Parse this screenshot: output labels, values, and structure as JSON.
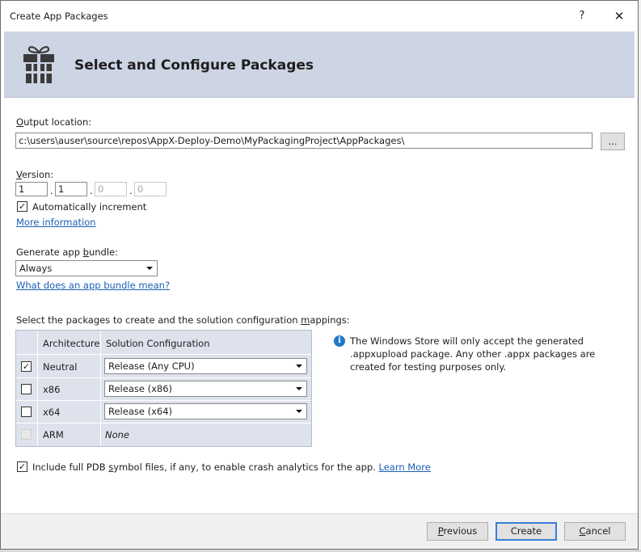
{
  "window": {
    "title": "Create App Packages",
    "help_label": "?",
    "close_label": "✕"
  },
  "header": {
    "title": "Select and Configure Packages",
    "icon": "package-gift-icon"
  },
  "output": {
    "label_prefix": "",
    "label_accel": "O",
    "label_rest": "utput location:",
    "value": "c:\\users\\auser\\source\\repos\\AppX-Deploy-Demo\\MyPackagingProject\\AppPackages\\",
    "browse_label": "..."
  },
  "version": {
    "label_accel": "V",
    "label_rest": "ersion:",
    "parts": [
      "1",
      "1",
      "0",
      "0"
    ],
    "separator": ".",
    "auto_increment_label": "Automatically increment",
    "auto_increment_checked": true,
    "more_info_link": "More information"
  },
  "bundle": {
    "label_prefix": "Generate app ",
    "label_accel": "b",
    "label_rest": "undle:",
    "selected": "Always",
    "help_link": "What does an app bundle mean?"
  },
  "packages": {
    "label_prefix": "Select the packages to create and the solution configuration ",
    "label_accel": "m",
    "label_rest": "appings:",
    "columns": [
      "Architecture",
      "Solution Configuration"
    ],
    "rows": [
      {
        "checked": true,
        "enabled": true,
        "arch": "Neutral",
        "config": "Release (Any CPU)",
        "has_combo": true
      },
      {
        "checked": false,
        "enabled": true,
        "arch": "x86",
        "config": "Release (x86)",
        "has_combo": true
      },
      {
        "checked": false,
        "enabled": true,
        "arch": "x64",
        "config": "Release (x64)",
        "has_combo": true
      },
      {
        "checked": false,
        "enabled": false,
        "arch": "ARM",
        "config": "None",
        "has_combo": false
      }
    ],
    "info_text": "The Windows Store will only accept the generated .appxupload package. Any other .appx packages are created for testing purposes only."
  },
  "pdb": {
    "checked": true,
    "label_prefix": "Include full PDB ",
    "label_accel": "s",
    "label_rest": "ymbol files, if any, to enable crash analytics for the app.",
    "learn_more_link": "Learn More"
  },
  "footer": {
    "previous_accel": "P",
    "previous_rest": "revious",
    "create_label": "Create",
    "cancel_accel": "C",
    "cancel_rest": "ancel"
  },
  "colors": {
    "header_bg": "#cdd4e4",
    "link": "#1a5fb4",
    "info_icon": "#1f78c8",
    "primary_border": "#3a7ed8"
  }
}
